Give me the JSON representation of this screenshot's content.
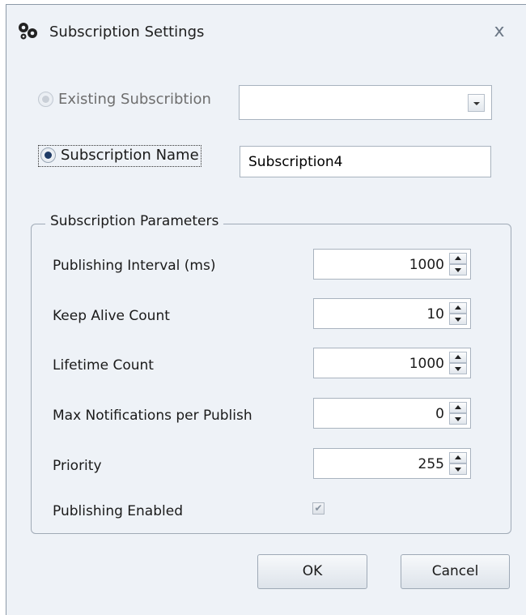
{
  "window": {
    "title": "Subscription Settings",
    "close_glyph": "x",
    "icon": "gears-icon"
  },
  "source": {
    "existing_label": "Existing Subscribtion",
    "existing_value": "",
    "name_label": "Subscription Name",
    "name_value": "Subscription4",
    "selected": "name"
  },
  "parameters": {
    "legend": "Subscription Parameters",
    "publishing_interval": {
      "label": "Publishing Interval (ms)",
      "value": "1000"
    },
    "keep_alive_count": {
      "label": "Keep Alive Count",
      "value": "10"
    },
    "lifetime_count": {
      "label": "Lifetime Count",
      "value": "1000"
    },
    "max_notifications": {
      "label": "Max Notifications per Publish",
      "value": "0"
    },
    "priority": {
      "label": "Priority",
      "value": "255"
    },
    "publishing_enabled": {
      "label": "Publishing Enabled",
      "checked": true,
      "disabled": true
    }
  },
  "buttons": {
    "ok": "OK",
    "cancel": "Cancel"
  },
  "colors": {
    "background": "#eef2f7",
    "selected_radio": "#1f3b66"
  }
}
